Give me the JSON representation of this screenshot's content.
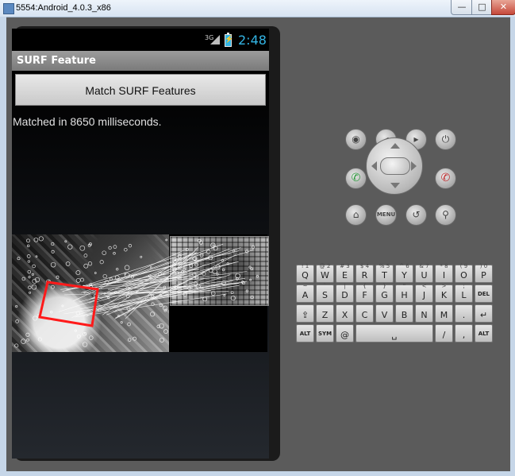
{
  "window": {
    "title": "5554:Android_4.0.3_x86",
    "minimize_label": "—",
    "maximize_label": "□",
    "close_label": "✕"
  },
  "status_bar": {
    "network": "3G",
    "time": "2:48"
  },
  "app": {
    "title": "SURF Feature",
    "button_label": "Match SURF Features",
    "result_text": "Matched in 8650 milliseconds."
  },
  "controls": {
    "camera": "camera-icon",
    "volume_down": "volume-down-icon",
    "volume_up": "volume-up-icon",
    "power": "power-icon",
    "call": "call-icon",
    "end_call": "end-call-icon",
    "home": "home-icon",
    "menu_label": "MENU",
    "back": "back-icon",
    "search": "search-icon"
  },
  "keyboard": {
    "row1": [
      {
        "key": "Q",
        "alt": "1"
      },
      {
        "key": "W",
        "alt": "2"
      },
      {
        "key": "E",
        "alt": "3"
      },
      {
        "key": "R",
        "alt": "4"
      },
      {
        "key": "T",
        "alt": "5"
      },
      {
        "key": "Y",
        "alt": "6"
      },
      {
        "key": "U",
        "alt": "7"
      },
      {
        "key": "I",
        "alt": "8"
      },
      {
        "key": "O",
        "alt": "9"
      },
      {
        "key": "P",
        "alt": "0"
      }
    ],
    "row1_symbols": [
      "!",
      "@",
      "#",
      "$",
      "%",
      "^",
      "&",
      "*",
      "(",
      ")"
    ],
    "row2": [
      {
        "key": "A",
        "alt": "~"
      },
      {
        "key": "S",
        "alt": "`"
      },
      {
        "key": "D",
        "alt": "|"
      },
      {
        "key": "F",
        "alt": "{"
      },
      {
        "key": "G",
        "alt": "}"
      },
      {
        "key": "H",
        "alt": "\""
      },
      {
        "key": "J",
        "alt": "<"
      },
      {
        "key": "K",
        "alt": ">"
      },
      {
        "key": "L",
        "alt": ";"
      }
    ],
    "row2_extra": {
      "key": "DEL"
    },
    "row3": [
      {
        "key": "Z"
      },
      {
        "key": "X"
      },
      {
        "key": "C"
      },
      {
        "key": "V"
      },
      {
        "key": "B"
      },
      {
        "key": "N"
      },
      {
        "key": "M"
      }
    ],
    "row3_extra": [
      {
        "key": "."
      }
    ],
    "row4": [
      {
        "key": "ALT"
      },
      {
        "key": "SYM"
      },
      {
        "key": "@"
      },
      {
        "key": "/"
      },
      {
        "key": ","
      },
      {
        "key": "ALT"
      }
    ]
  },
  "colors": {
    "accent": "#33b5e5",
    "match_box": "#ff1a1a"
  }
}
